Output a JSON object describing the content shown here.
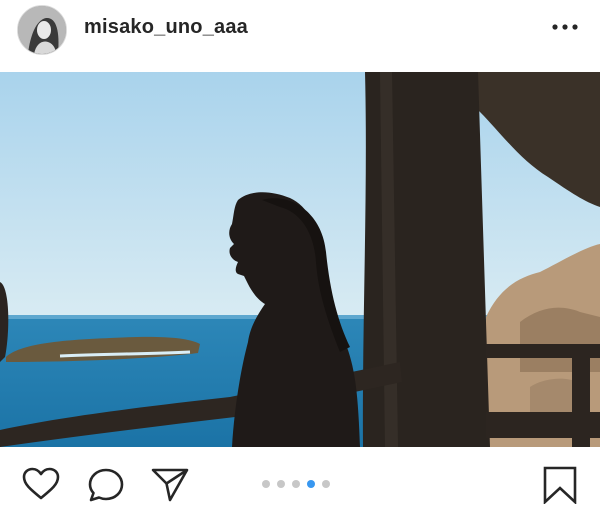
{
  "header": {
    "username": "misako_uno_aaa",
    "more_icon": "more-horizontal-icon"
  },
  "carousel": {
    "slide_count": 5,
    "active_index": 3,
    "active_color": "#3897f0",
    "inactive_color": "#c7c7c7"
  },
  "actions": {
    "like_icon": "heart-icon",
    "comment_icon": "comment-bubble-icon",
    "share_icon": "paper-plane-icon",
    "save_icon": "bookmark-icon"
  }
}
